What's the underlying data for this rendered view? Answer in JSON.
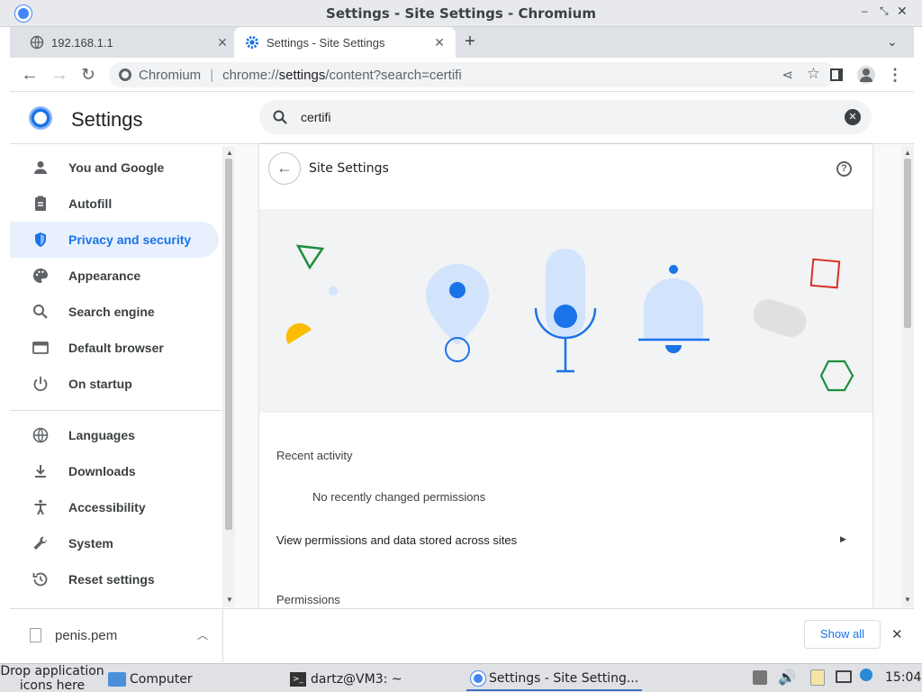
{
  "window": {
    "title": "Settings - Site Settings - Chromium"
  },
  "tabs": [
    {
      "label": "192.168.1.1"
    },
    {
      "label": "Settings - Site Settings"
    }
  ],
  "omnibox": {
    "site": "Chromium",
    "url_scheme": "chrome://",
    "url_host": "settings",
    "url_path": "/content?search=certifi"
  },
  "settings": {
    "title": "Settings",
    "search_value": "certifi",
    "nav": [
      {
        "label": "You and Google",
        "icon": "person-icon"
      },
      {
        "label": "Autofill",
        "icon": "clipboard-icon"
      },
      {
        "label": "Privacy and security",
        "icon": "shield-icon",
        "active": true
      },
      {
        "label": "Appearance",
        "icon": "palette-icon"
      },
      {
        "label": "Search engine",
        "icon": "search-icon"
      },
      {
        "label": "Default browser",
        "icon": "browser-icon"
      },
      {
        "label": "On startup",
        "icon": "power-icon"
      },
      {
        "label": "Languages",
        "icon": "globe-icon"
      },
      {
        "label": "Downloads",
        "icon": "download-icon"
      },
      {
        "label": "Accessibility",
        "icon": "accessibility-icon"
      },
      {
        "label": "System",
        "icon": "wrench-icon"
      },
      {
        "label": "Reset settings",
        "icon": "history-icon"
      }
    ],
    "page": {
      "heading": "Site Settings",
      "recent_activity": "Recent activity",
      "no_recent": "No recently changed permissions",
      "view_permissions": "View permissions and data stored across sites",
      "permissions": "Permissions"
    }
  },
  "download": {
    "filename": "penis.pem",
    "show_all": "Show all"
  },
  "taskbar": {
    "drop_hint_line1": "Drop application",
    "drop_hint_line2": "icons here",
    "items": [
      "Computer",
      "dartz@VM3: ~",
      "Settings - Site Setting..."
    ],
    "clock": "15:04"
  },
  "colors": {
    "accent": "#1a73e8",
    "active_bg": "#e8f0fe"
  }
}
